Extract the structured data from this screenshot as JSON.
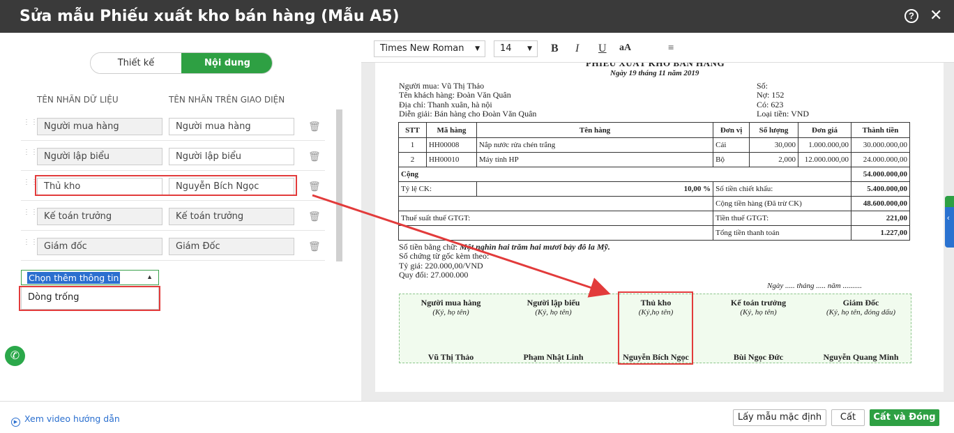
{
  "window": {
    "title": "Sửa mẫu Phiếu xuất kho bán hàng (Mẫu A5)",
    "help_icon": "?",
    "close_icon": "✕"
  },
  "tabs": {
    "design": "Thiết kế",
    "content": "Nội dung"
  },
  "columns": {
    "data_label": "TÊN NHÃN DỮ LIỆU",
    "ui_label": "TÊN NHÃN TRÊN GIAO DIỆN"
  },
  "rows": [
    {
      "data": "Người mua hàng",
      "ui": "Người mua hàng"
    },
    {
      "data": "Người lập biểu",
      "ui": "Người lập biểu"
    },
    {
      "data": "Thủ kho",
      "ui": "Nguyễn Bích Ngọc"
    },
    {
      "data": "Kế toán trưởng",
      "ui": "Kế toán trưởng"
    },
    {
      "data": "Giám đốc",
      "ui": "Giám Đốc"
    }
  ],
  "add_select": {
    "value": "Chọn thêm thông tin",
    "option": "Dòng trống"
  },
  "toolbar": {
    "font": "Times New Roman",
    "size": "14",
    "bold": "B",
    "italic": "I",
    "underline": "U",
    "case": "aA"
  },
  "doc": {
    "title": "PHIẾU XUẤT KHO BÁN HÀNG",
    "date": "Ngày 19 tháng 11 năm 2019",
    "buyer": "Người mua: Vũ Thị Thảo",
    "customer": "Tên khách hàng: Đoàn Văn Quân",
    "address": "Địa chỉ: Thanh xuân, hà nội",
    "note": "Diễn giải: Bán hàng cho Đoàn Văn Quân",
    "so": "Số:",
    "no": "Nợ: 152",
    "co": "Có: 623",
    "currency": "Loại tiền: VND",
    "table_headers": [
      "STT",
      "Mã hàng",
      "Tên hàng",
      "Đơn vị",
      "Số lượng",
      "Đơn giá",
      "Thành tiền"
    ],
    "items": [
      [
        "1",
        "HH00008",
        "Nắp nước rửa chén trắng",
        "Cái",
        "30,000",
        "1.000.000,00",
        "30.000.000,00"
      ],
      [
        "2",
        "HH00010",
        "Máy tính HP",
        "Bộ",
        "2,000",
        "12.000.000,00",
        "24.000.000,00"
      ]
    ],
    "total_label": "Cộng",
    "total_value": "54.000.000,00",
    "discount_rate_label": "Tỷ lệ CK:",
    "discount_rate": "10,00 %",
    "discount_amount_label": "Số tiền chiết khấu:",
    "discount_amount": "5.400.000,00",
    "net_label": "Cộng tiền hàng (Đã trừ CK)",
    "net_value": "48.600.000,00",
    "vat_rate_label": "Thuế suất thuế GTGT:",
    "vat_label": "Tiền thuế GTGT:",
    "vat_value": "221,00",
    "grand_label": "Tổng tiền thanh toán",
    "grand_value": "1.227,00",
    "words_label": "Số tiền bằng chữ:",
    "words": "Một nghìn hai trăm hai mươi bảy đô la Mỹ.",
    "docs": "Số chứng từ gốc kèm theo:",
    "rate": "Tỷ giá: 220.000,00/VND",
    "exchange": "Quy đổi: 27.000.000",
    "sign_date": "Ngày ..... tháng ..... năm ..........",
    "signers": [
      {
        "title": "Người mua hàng",
        "sub": "(Ký, họ tên)",
        "name": "Vũ Thị Thảo"
      },
      {
        "title": "Người lập biểu",
        "sub": "(Ký, họ tên)",
        "name": "Phạm Nhật Linh"
      },
      {
        "title": "Thủ kho",
        "sub": "(Ký,họ tên)",
        "name": "Nguyễn Bích Ngọc"
      },
      {
        "title": "Kế toán trưởng",
        "sub": "(Ký, họ tên)",
        "name": "Bùi Ngọc Đức"
      },
      {
        "title": "Giám Đốc",
        "sub": "(Ký, họ tên, đóng dấu)",
        "name": "Nguyễn Quang Minh"
      }
    ]
  },
  "footer": {
    "help_link": "Xem video hướng dẫn",
    "default_button": "Lấy mẫu mặc định",
    "save_button": "Cất",
    "save_close_button": "Cất và Đóng"
  }
}
